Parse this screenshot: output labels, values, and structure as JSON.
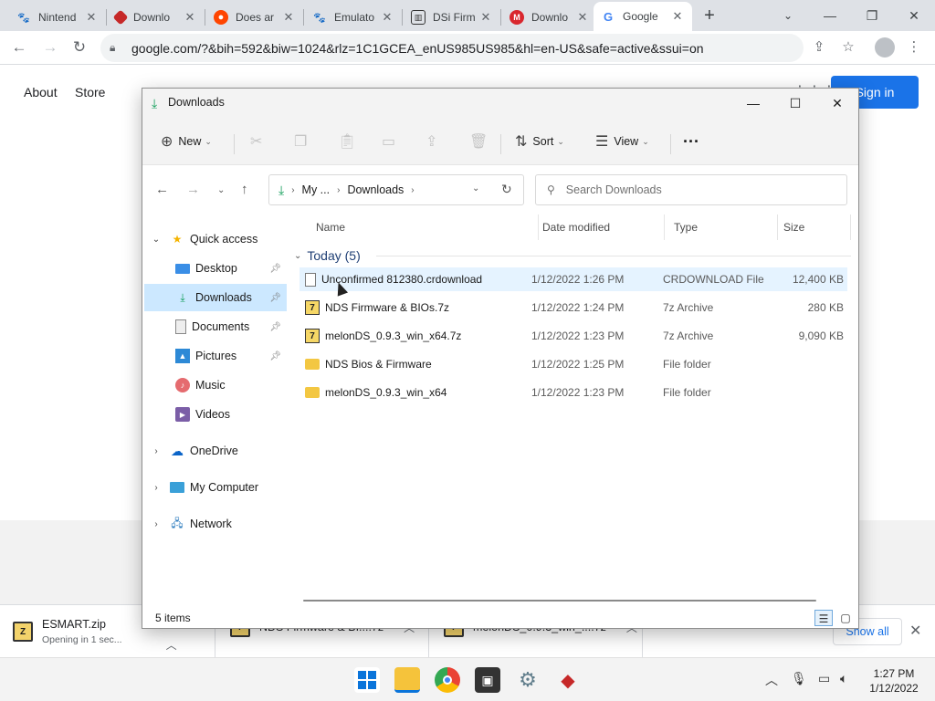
{
  "browser": {
    "tabs": [
      {
        "title": "Nintend",
        "favicon": "paw-icon",
        "active": false
      },
      {
        "title": "Downlo",
        "favicon": "diamond-icon",
        "active": false
      },
      {
        "title": "Does ar",
        "favicon": "reddit-icon",
        "active": false
      },
      {
        "title": "Emulato",
        "favicon": "paw-icon",
        "active": false
      },
      {
        "title": "DSi Firm",
        "favicon": "box-icon",
        "active": false
      },
      {
        "title": "Downlo",
        "favicon": "mega-icon",
        "active": false
      },
      {
        "title": "Google",
        "favicon": "google-icon",
        "active": true
      }
    ],
    "new_tab_label": "+",
    "url": "google.com/?&bih=592&biw=1024&rlz=1C1GCEA_enUS985US985&hl=en-US&safe=active&ssui=on"
  },
  "google_page": {
    "links": [
      "About",
      "Store"
    ],
    "sign_in_label": "Sign in"
  },
  "explorer": {
    "title": "Downloads",
    "commands": {
      "new_label": "New",
      "sort_label": "Sort",
      "view_label": "View",
      "more_label": "···"
    },
    "breadcrumb": [
      "My ...",
      "Downloads"
    ],
    "search_placeholder": "Search Downloads",
    "nav": {
      "quick_access": "Quick access",
      "pinned": [
        "Desktop",
        "Downloads",
        "Documents",
        "Pictures"
      ],
      "unpinned": [
        "Music",
        "Videos"
      ],
      "onedrive": "OneDrive",
      "my_computer": "My Computer",
      "network": "Network"
    },
    "columns": [
      "Name",
      "Date modified",
      "Type",
      "Size"
    ],
    "group_label": "Today (5)",
    "files": [
      {
        "name": "Unconfirmed 812380.crdownload",
        "date": "1/12/2022 1:26 PM",
        "type": "CRDOWNLOAD File",
        "size": "12,400 KB",
        "icon": "document-icon"
      },
      {
        "name": "NDS Firmware & BIOs.7z",
        "date": "1/12/2022 1:24 PM",
        "type": "7z Archive",
        "size": "280 KB",
        "icon": "7z-archive-icon"
      },
      {
        "name": "melonDS_0.9.3_win_x64.7z",
        "date": "1/12/2022 1:23 PM",
        "type": "7z Archive",
        "size": "9,090 KB",
        "icon": "7z-archive-icon"
      },
      {
        "name": "NDS Bios & Firmware",
        "date": "1/12/2022 1:25 PM",
        "type": "File folder",
        "size": "",
        "icon": "folder-icon"
      },
      {
        "name": "melonDS_0.9.3_win_x64",
        "date": "1/12/2022 1:23 PM",
        "type": "File folder",
        "size": "",
        "icon": "folder-icon"
      }
    ],
    "status": "5 items"
  },
  "downloads_shelf": {
    "items": [
      {
        "name": "ESMART.zip",
        "sub": "Opening in 1 sec..."
      },
      {
        "name": "NDS Firmware & BI....7z",
        "sub": ""
      },
      {
        "name": "melonDS_0.9.3_win_....7z",
        "sub": ""
      }
    ],
    "show_all_label": "Show all"
  },
  "taskbar": {
    "time": "1:27 PM",
    "date": "1/12/2022"
  },
  "colors": {
    "accent_blue": "#1a73e8",
    "selection_blue": "#cce8ff",
    "hover_blue": "#e5f3ff",
    "download_green": "#0f9d58"
  }
}
